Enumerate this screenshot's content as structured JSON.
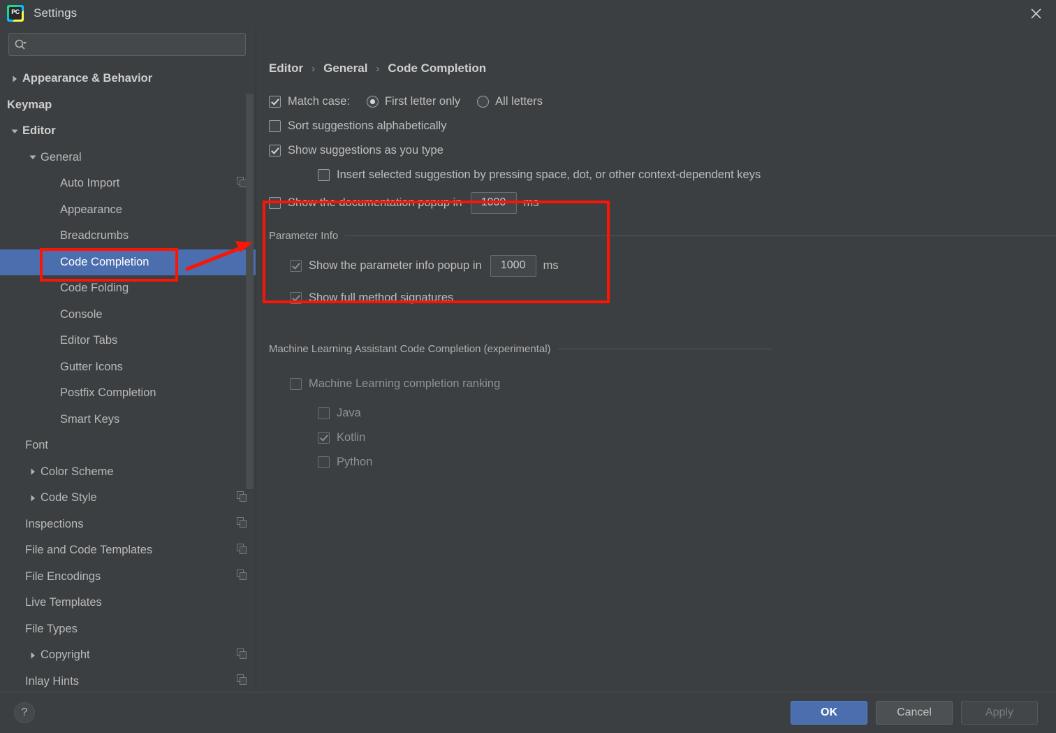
{
  "window": {
    "title": "Settings",
    "app_icon": "pycharm-icon",
    "close_icon": "close-icon"
  },
  "sidebar": {
    "search": {
      "placeholder": "",
      "value": "",
      "icon": "search-icon",
      "dropdown_icon": "chevron-down-icon"
    },
    "items": [
      {
        "label": "Appearance & Behavior",
        "level": 0,
        "twisty": "collapsed",
        "bold": true,
        "badge": false
      },
      {
        "label": "Keymap",
        "level": 0,
        "twisty": "none",
        "bold": true,
        "badge": false
      },
      {
        "label": "Editor",
        "level": 0,
        "twisty": "expanded",
        "bold": true,
        "badge": false
      },
      {
        "label": "General",
        "level": 1,
        "twisty": "expanded",
        "bold": false,
        "badge": false
      },
      {
        "label": "Auto Import",
        "level": 2,
        "twisty": "none",
        "bold": false,
        "badge": true
      },
      {
        "label": "Appearance",
        "level": 2,
        "twisty": "none",
        "bold": false,
        "badge": false
      },
      {
        "label": "Breadcrumbs",
        "level": 2,
        "twisty": "none",
        "bold": false,
        "badge": false
      },
      {
        "label": "Code Completion",
        "level": 2,
        "twisty": "none",
        "bold": false,
        "badge": false,
        "selected": true
      },
      {
        "label": "Code Folding",
        "level": 2,
        "twisty": "none",
        "bold": false,
        "badge": false
      },
      {
        "label": "Console",
        "level": 2,
        "twisty": "none",
        "bold": false,
        "badge": false
      },
      {
        "label": "Editor Tabs",
        "level": 2,
        "twisty": "none",
        "bold": false,
        "badge": false
      },
      {
        "label": "Gutter Icons",
        "level": 2,
        "twisty": "none",
        "bold": false,
        "badge": false
      },
      {
        "label": "Postfix Completion",
        "level": 2,
        "twisty": "none",
        "bold": false,
        "badge": false
      },
      {
        "label": "Smart Keys",
        "level": 2,
        "twisty": "none",
        "bold": false,
        "badge": false
      },
      {
        "label": "Font",
        "level": 1,
        "twisty": "none",
        "bold": false,
        "badge": false
      },
      {
        "label": "Color Scheme",
        "level": 1,
        "twisty": "collapsed",
        "bold": false,
        "badge": false
      },
      {
        "label": "Code Style",
        "level": 1,
        "twisty": "collapsed",
        "bold": false,
        "badge": true
      },
      {
        "label": "Inspections",
        "level": 1,
        "twisty": "none",
        "bold": false,
        "badge": true
      },
      {
        "label": "File and Code Templates",
        "level": 1,
        "twisty": "none",
        "bold": false,
        "badge": true
      },
      {
        "label": "File Encodings",
        "level": 1,
        "twisty": "none",
        "bold": false,
        "badge": true
      },
      {
        "label": "Live Templates",
        "level": 1,
        "twisty": "none",
        "bold": false,
        "badge": false
      },
      {
        "label": "File Types",
        "level": 1,
        "twisty": "none",
        "bold": false,
        "badge": false
      },
      {
        "label": "Copyright",
        "level": 1,
        "twisty": "collapsed",
        "bold": false,
        "badge": true
      },
      {
        "label": "Inlay Hints",
        "level": 1,
        "twisty": "none",
        "bold": false,
        "badge": true
      }
    ]
  },
  "main": {
    "breadcrumb": {
      "items": [
        "Editor",
        "General",
        "Code Completion"
      ],
      "separator": "›"
    },
    "match_case": {
      "label": "Match case:",
      "checked": true,
      "radios": [
        {
          "label": "First letter only",
          "selected": true
        },
        {
          "label": "All letters",
          "selected": false
        }
      ]
    },
    "sort_suggestions": {
      "label": "Sort suggestions alphabetically",
      "checked": false
    },
    "show_suggestions": {
      "label": "Show suggestions as you type",
      "checked": true
    },
    "insert_selected": {
      "label": "Insert selected suggestion by pressing space, dot, or other context-dependent keys",
      "checked": false
    },
    "documentation_popup": {
      "label": "Show the documentation popup in",
      "checked": false,
      "value": "1000",
      "unit": "ms"
    },
    "parameter_info": {
      "group_label": "Parameter Info",
      "popup": {
        "label": "Show the parameter info popup in",
        "checked": true,
        "value": "1000",
        "unit": "ms"
      },
      "full_signatures": {
        "label": "Show full method signatures",
        "checked": true
      }
    },
    "ml_assistant": {
      "group_label": "Machine Learning Assistant Code Completion (experimental)",
      "ranking": {
        "label": "Machine Learning completion ranking",
        "checked": false
      },
      "languages": [
        {
          "label": "Java",
          "checked": false
        },
        {
          "label": "Kotlin",
          "checked": true
        },
        {
          "label": "Python",
          "checked": false
        }
      ]
    }
  },
  "annotations": {
    "highlight_color": "#fc1404",
    "boxes": [
      "sidebar-code-completion",
      "parameter-info-group"
    ],
    "arrow": "red-arrow-pointing-to-code-completion"
  },
  "footer": {
    "help_icon": "question-mark-icon",
    "ok_label": "OK",
    "cancel_label": "Cancel",
    "apply_label": "Apply",
    "apply_disabled": true
  },
  "theme": {
    "background": "#3c3f41",
    "selection_blue": "#4b6eaf",
    "text": "#bdbdbd"
  }
}
